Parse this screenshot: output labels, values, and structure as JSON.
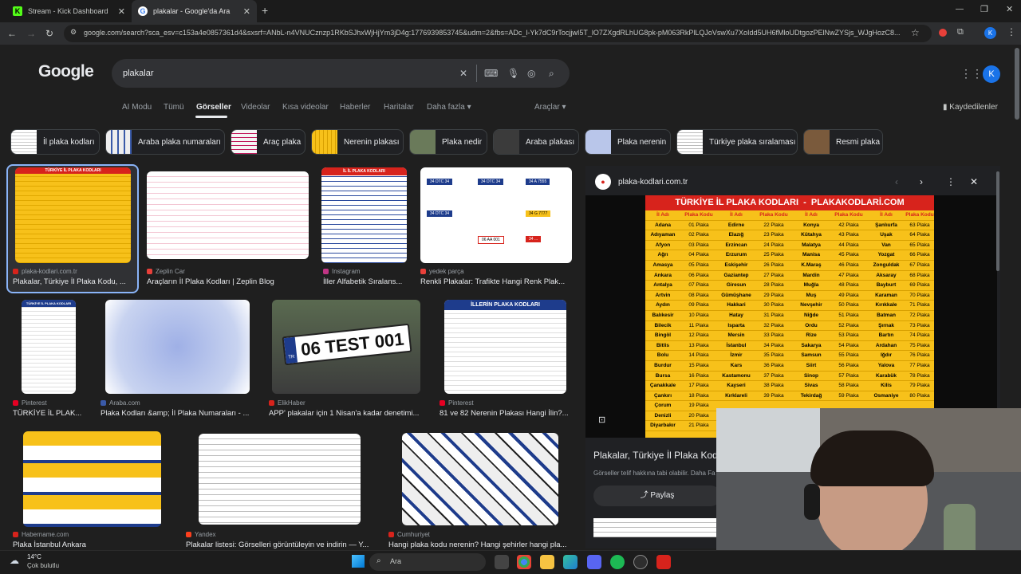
{
  "tabs": [
    {
      "title": "Stream - Kick Dashboard",
      "icon": "K"
    },
    {
      "title": "plakalar - Google'da Ara",
      "icon": "G"
    }
  ],
  "url": "google.com/search?sca_esv=c153a4e0857361d4&sxsrf=ANbL-n4VNUCznzp1RKbSJhxWjHjYm3jD4g:1776939853745&udm=2&fbs=ADc_l-Yk7dC9rTocjjwI5T_lO7ZXgdRLhUG8pk-pM063RkPlLQJoVswXu7XoIdd5UH6fMloUDtgozPElNwZYSjs_WJgHozC8...",
  "profile_initial": "K",
  "google": {
    "logo": "Google",
    "query": "plakalar"
  },
  "nav": {
    "links": [
      "AI Modu",
      "Tümü",
      "Görseller",
      "Videolar",
      "Kısa videolar",
      "Haberler",
      "Haritalar",
      "Daha fazla"
    ],
    "tools": "Araçlar",
    "saved": "Kaydedilenler"
  },
  "chips": [
    "İl plaka kodları",
    "Araba plaka numaraları",
    "Araç plaka",
    "Nerenin plakası",
    "Plaka nedir",
    "Araba plakası",
    "Plaka nerenin",
    "Türkiye plaka sıralaması",
    "Resmi plaka"
  ],
  "results": [
    {
      "source": "plaka-kodlari.com.tr",
      "title": "Plakalar, Türkiye İl Plaka Kodu, ..."
    },
    {
      "source": "Zeplin Car",
      "title": "Araçların İl Plaka Kodları | Zeplin Blog"
    },
    {
      "source": "Instagram",
      "title": "İller Alfabetik Sıralans..."
    },
    {
      "source": "yedek parça",
      "title": "Renkli Plakalar: Trafikte Hangi Renk Plak..."
    },
    {
      "source": "Pinterest",
      "title": "TÜRKİYE İL PLAK..."
    },
    {
      "source": "Araba.com",
      "title": "Plaka Kodları &amp; İl Plaka Numaraları - ..."
    },
    {
      "source": "ElikHaber",
      "title": "APP' plakalar için 1 Nisan'a kadar denetimi..."
    },
    {
      "source": "Pinterest",
      "title": "81 ve 82 Nerenin Plakası Hangi İlin?..."
    },
    {
      "source": "Habername.com",
      "title": "Plaka İstanbul Ankara"
    },
    {
      "source": "Yandex",
      "title": "Plakalar listesi: Görselleri görüntüleyin ve indirin — Y..."
    },
    {
      "source": "Cumhuriyet",
      "title": "Hangi plaka kodu nerenin? Hangi şehirler hangi pla..."
    }
  ],
  "thumb_text": {
    "r1_header": "TÜRKİYE İL PLAKA KODLARI",
    "r3_header": "İL İL PLAKA KODLARI",
    "r5_header": "TÜRKİYE İL PLAKA KODLARI",
    "r7_plate": "06 TEST 001",
    "r7_tr": "TR",
    "r8_header": "İLLERİN PLAKA KODLARI",
    "r4_plates": [
      "34 DTC 34",
      "34 DTC 34",
      "34 A 7555",
      "34 DTC 34",
      "34 G 7777",
      "06 AA 001",
      "34 ..."
    ]
  },
  "preview": {
    "site": "plaka-kodlari.com.tr",
    "title": "Plakalar, Türkiye İl Plaka Kodu",
    "notice": "Görseller telif hakkına tabi olabilir.",
    "notice_more": "Daha Fa",
    "share": "Paylaş",
    "table_title": "TÜRKİYE İL PLAKA KODLARI  -  PLAKAKODLARİ.COM",
    "col_heads": [
      "İl Adı",
      "Plaka Kodu",
      "İl Adı",
      "Plaka Kodu",
      "İl Adı",
      "Plaka Kodu",
      "İl Adı",
      "Plaka Kodu"
    ],
    "rows": [
      [
        "Adana",
        "01 Plaka",
        "Edirne",
        "22 Plaka",
        "Konya",
        "42 Plaka",
        "Şanlıurfa",
        "63 Plaka"
      ],
      [
        "Adıyaman",
        "02 Plaka",
        "Elazığ",
        "23 Plaka",
        "Kütahya",
        "43 Plaka",
        "Uşak",
        "64 Plaka"
      ],
      [
        "Afyon",
        "03 Plaka",
        "Erzincan",
        "24 Plaka",
        "Malatya",
        "44 Plaka",
        "Van",
        "65 Plaka"
      ],
      [
        "Ağrı",
        "04 Plaka",
        "Erzurum",
        "25 Plaka",
        "Manisa",
        "45 Plaka",
        "Yozgat",
        "66 Plaka"
      ],
      [
        "Amasya",
        "05 Plaka",
        "Eskişehir",
        "26 Plaka",
        "K.Maraş",
        "46 Plaka",
        "Zonguldak",
        "67 Plaka"
      ],
      [
        "Ankara",
        "06 Plaka",
        "Gaziantep",
        "27 Plaka",
        "Mardin",
        "47 Plaka",
        "Aksaray",
        "68 Plaka"
      ],
      [
        "Antalya",
        "07 Plaka",
        "Giresun",
        "28 Plaka",
        "Muğla",
        "48 Plaka",
        "Bayburt",
        "69 Plaka"
      ],
      [
        "Artvin",
        "08 Plaka",
        "Gümüşhane",
        "29 Plaka",
        "Muş",
        "49 Plaka",
        "Karaman",
        "70 Plaka"
      ],
      [
        "Aydın",
        "09 Plaka",
        "Hakkari",
        "30 Plaka",
        "Nevşehir",
        "50 Plaka",
        "Kırıkkale",
        "71 Plaka"
      ],
      [
        "Balıkesir",
        "10 Plaka",
        "Hatay",
        "31 Plaka",
        "Niğde",
        "51 Plaka",
        "Batman",
        "72 Plaka"
      ],
      [
        "Bilecik",
        "11 Plaka",
        "Isparta",
        "32 Plaka",
        "Ordu",
        "52 Plaka",
        "Şırnak",
        "73 Plaka"
      ],
      [
        "Bingöl",
        "12 Plaka",
        "Mersin",
        "33 Plaka",
        "Rize",
        "53 Plaka",
        "Bartın",
        "74 Plaka"
      ],
      [
        "Bitlis",
        "13 Plaka",
        "İstanbul",
        "34 Plaka",
        "Sakarya",
        "54 Plaka",
        "Ardahan",
        "75 Plaka"
      ],
      [
        "Bolu",
        "14 Plaka",
        "İzmir",
        "35 Plaka",
        "Samsun",
        "55 Plaka",
        "Iğdır",
        "76 Plaka"
      ],
      [
        "Burdur",
        "15 Plaka",
        "Kars",
        "36 Plaka",
        "Siirt",
        "56 Plaka",
        "Yalova",
        "77 Plaka"
      ],
      [
        "Bursa",
        "16 Plaka",
        "Kastamonu",
        "37 Plaka",
        "Sinop",
        "57 Plaka",
        "Karabük",
        "78 Plaka"
      ],
      [
        "Çanakkale",
        "17 Plaka",
        "Kayseri",
        "38 Plaka",
        "Sivas",
        "58 Plaka",
        "Kilis",
        "79 Plaka"
      ],
      [
        "Çankırı",
        "18 Plaka",
        "Kırklareli",
        "39 Plaka",
        "Tekirdağ",
        "59 Plaka",
        "Osmaniye",
        "80 Plaka"
      ],
      [
        "Çorum",
        "19 Plaka",
        "",
        "",
        "",
        "",
        "",
        ""
      ],
      [
        "Denizli",
        "20 Plaka",
        "",
        "",
        "",
        "",
        "",
        ""
      ],
      [
        "Diyarbakır",
        "21 Plaka",
        "",
        "",
        "",
        "",
        "",
        ""
      ]
    ]
  },
  "taskbar": {
    "temp": "14°C",
    "weather": "Çok bulutlu",
    "search": "Ara"
  },
  "colors": {
    "table_yellow": "#f7c11a",
    "table_red": "#d7231c",
    "link_blue": "#8ab4f8"
  }
}
